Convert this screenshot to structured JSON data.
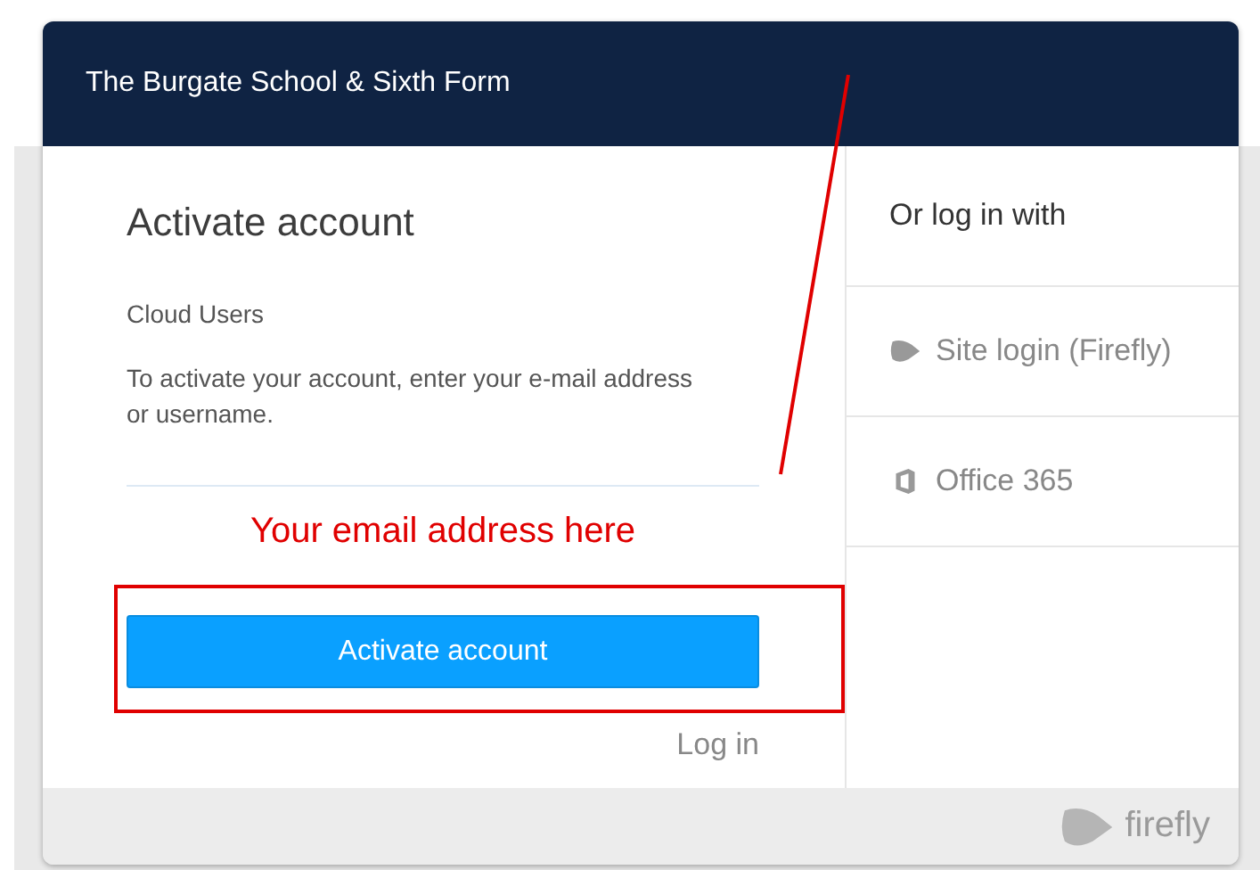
{
  "header": {
    "title": "The Burgate School & Sixth Form"
  },
  "activation": {
    "heading": "Activate account",
    "subheading": "Cloud Users",
    "instructions": "To activate your account, enter your e-mail address or username.",
    "button": "Activate account",
    "login_link": "Log in"
  },
  "annotation": {
    "label": "Your email address here"
  },
  "sidebar": {
    "heading": "Or log in with",
    "options": [
      {
        "kind": "firefly",
        "label": "Site login (Firefly)"
      },
      {
        "kind": "office",
        "label": "Office 365"
      }
    ]
  },
  "footer": {
    "brand": "firefly"
  }
}
